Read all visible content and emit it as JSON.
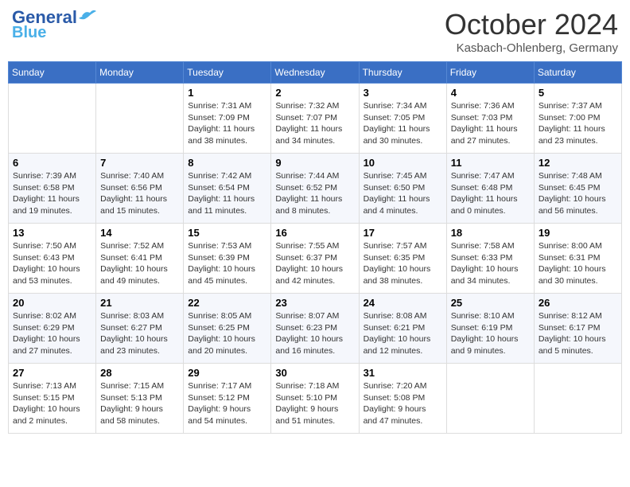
{
  "header": {
    "logo_line1": "General",
    "logo_line2": "Blue",
    "month_title": "October 2024",
    "location": "Kasbach-Ohlenberg, Germany"
  },
  "weekdays": [
    "Sunday",
    "Monday",
    "Tuesday",
    "Wednesday",
    "Thursday",
    "Friday",
    "Saturday"
  ],
  "weeks": [
    [
      {
        "day": "",
        "sunrise": "",
        "sunset": "",
        "daylight": ""
      },
      {
        "day": "",
        "sunrise": "",
        "sunset": "",
        "daylight": ""
      },
      {
        "day": "1",
        "sunrise": "Sunrise: 7:31 AM",
        "sunset": "Sunset: 7:09 PM",
        "daylight": "Daylight: 11 hours and 38 minutes."
      },
      {
        "day": "2",
        "sunrise": "Sunrise: 7:32 AM",
        "sunset": "Sunset: 7:07 PM",
        "daylight": "Daylight: 11 hours and 34 minutes."
      },
      {
        "day": "3",
        "sunrise": "Sunrise: 7:34 AM",
        "sunset": "Sunset: 7:05 PM",
        "daylight": "Daylight: 11 hours and 30 minutes."
      },
      {
        "day": "4",
        "sunrise": "Sunrise: 7:36 AM",
        "sunset": "Sunset: 7:03 PM",
        "daylight": "Daylight: 11 hours and 27 minutes."
      },
      {
        "day": "5",
        "sunrise": "Sunrise: 7:37 AM",
        "sunset": "Sunset: 7:00 PM",
        "daylight": "Daylight: 11 hours and 23 minutes."
      }
    ],
    [
      {
        "day": "6",
        "sunrise": "Sunrise: 7:39 AM",
        "sunset": "Sunset: 6:58 PM",
        "daylight": "Daylight: 11 hours and 19 minutes."
      },
      {
        "day": "7",
        "sunrise": "Sunrise: 7:40 AM",
        "sunset": "Sunset: 6:56 PM",
        "daylight": "Daylight: 11 hours and 15 minutes."
      },
      {
        "day": "8",
        "sunrise": "Sunrise: 7:42 AM",
        "sunset": "Sunset: 6:54 PM",
        "daylight": "Daylight: 11 hours and 11 minutes."
      },
      {
        "day": "9",
        "sunrise": "Sunrise: 7:44 AM",
        "sunset": "Sunset: 6:52 PM",
        "daylight": "Daylight: 11 hours and 8 minutes."
      },
      {
        "day": "10",
        "sunrise": "Sunrise: 7:45 AM",
        "sunset": "Sunset: 6:50 PM",
        "daylight": "Daylight: 11 hours and 4 minutes."
      },
      {
        "day": "11",
        "sunrise": "Sunrise: 7:47 AM",
        "sunset": "Sunset: 6:48 PM",
        "daylight": "Daylight: 11 hours and 0 minutes."
      },
      {
        "day": "12",
        "sunrise": "Sunrise: 7:48 AM",
        "sunset": "Sunset: 6:45 PM",
        "daylight": "Daylight: 10 hours and 56 minutes."
      }
    ],
    [
      {
        "day": "13",
        "sunrise": "Sunrise: 7:50 AM",
        "sunset": "Sunset: 6:43 PM",
        "daylight": "Daylight: 10 hours and 53 minutes."
      },
      {
        "day": "14",
        "sunrise": "Sunrise: 7:52 AM",
        "sunset": "Sunset: 6:41 PM",
        "daylight": "Daylight: 10 hours and 49 minutes."
      },
      {
        "day": "15",
        "sunrise": "Sunrise: 7:53 AM",
        "sunset": "Sunset: 6:39 PM",
        "daylight": "Daylight: 10 hours and 45 minutes."
      },
      {
        "day": "16",
        "sunrise": "Sunrise: 7:55 AM",
        "sunset": "Sunset: 6:37 PM",
        "daylight": "Daylight: 10 hours and 42 minutes."
      },
      {
        "day": "17",
        "sunrise": "Sunrise: 7:57 AM",
        "sunset": "Sunset: 6:35 PM",
        "daylight": "Daylight: 10 hours and 38 minutes."
      },
      {
        "day": "18",
        "sunrise": "Sunrise: 7:58 AM",
        "sunset": "Sunset: 6:33 PM",
        "daylight": "Daylight: 10 hours and 34 minutes."
      },
      {
        "day": "19",
        "sunrise": "Sunrise: 8:00 AM",
        "sunset": "Sunset: 6:31 PM",
        "daylight": "Daylight: 10 hours and 30 minutes."
      }
    ],
    [
      {
        "day": "20",
        "sunrise": "Sunrise: 8:02 AM",
        "sunset": "Sunset: 6:29 PM",
        "daylight": "Daylight: 10 hours and 27 minutes."
      },
      {
        "day": "21",
        "sunrise": "Sunrise: 8:03 AM",
        "sunset": "Sunset: 6:27 PM",
        "daylight": "Daylight: 10 hours and 23 minutes."
      },
      {
        "day": "22",
        "sunrise": "Sunrise: 8:05 AM",
        "sunset": "Sunset: 6:25 PM",
        "daylight": "Daylight: 10 hours and 20 minutes."
      },
      {
        "day": "23",
        "sunrise": "Sunrise: 8:07 AM",
        "sunset": "Sunset: 6:23 PM",
        "daylight": "Daylight: 10 hours and 16 minutes."
      },
      {
        "day": "24",
        "sunrise": "Sunrise: 8:08 AM",
        "sunset": "Sunset: 6:21 PM",
        "daylight": "Daylight: 10 hours and 12 minutes."
      },
      {
        "day": "25",
        "sunrise": "Sunrise: 8:10 AM",
        "sunset": "Sunset: 6:19 PM",
        "daylight": "Daylight: 10 hours and 9 minutes."
      },
      {
        "day": "26",
        "sunrise": "Sunrise: 8:12 AM",
        "sunset": "Sunset: 6:17 PM",
        "daylight": "Daylight: 10 hours and 5 minutes."
      }
    ],
    [
      {
        "day": "27",
        "sunrise": "Sunrise: 7:13 AM",
        "sunset": "Sunset: 5:15 PM",
        "daylight": "Daylight: 10 hours and 2 minutes."
      },
      {
        "day": "28",
        "sunrise": "Sunrise: 7:15 AM",
        "sunset": "Sunset: 5:13 PM",
        "daylight": "Daylight: 9 hours and 58 minutes."
      },
      {
        "day": "29",
        "sunrise": "Sunrise: 7:17 AM",
        "sunset": "Sunset: 5:12 PM",
        "daylight": "Daylight: 9 hours and 54 minutes."
      },
      {
        "day": "30",
        "sunrise": "Sunrise: 7:18 AM",
        "sunset": "Sunset: 5:10 PM",
        "daylight": "Daylight: 9 hours and 51 minutes."
      },
      {
        "day": "31",
        "sunrise": "Sunrise: 7:20 AM",
        "sunset": "Sunset: 5:08 PM",
        "daylight": "Daylight: 9 hours and 47 minutes."
      },
      {
        "day": "",
        "sunrise": "",
        "sunset": "",
        "daylight": ""
      },
      {
        "day": "",
        "sunrise": "",
        "sunset": "",
        "daylight": ""
      }
    ]
  ]
}
